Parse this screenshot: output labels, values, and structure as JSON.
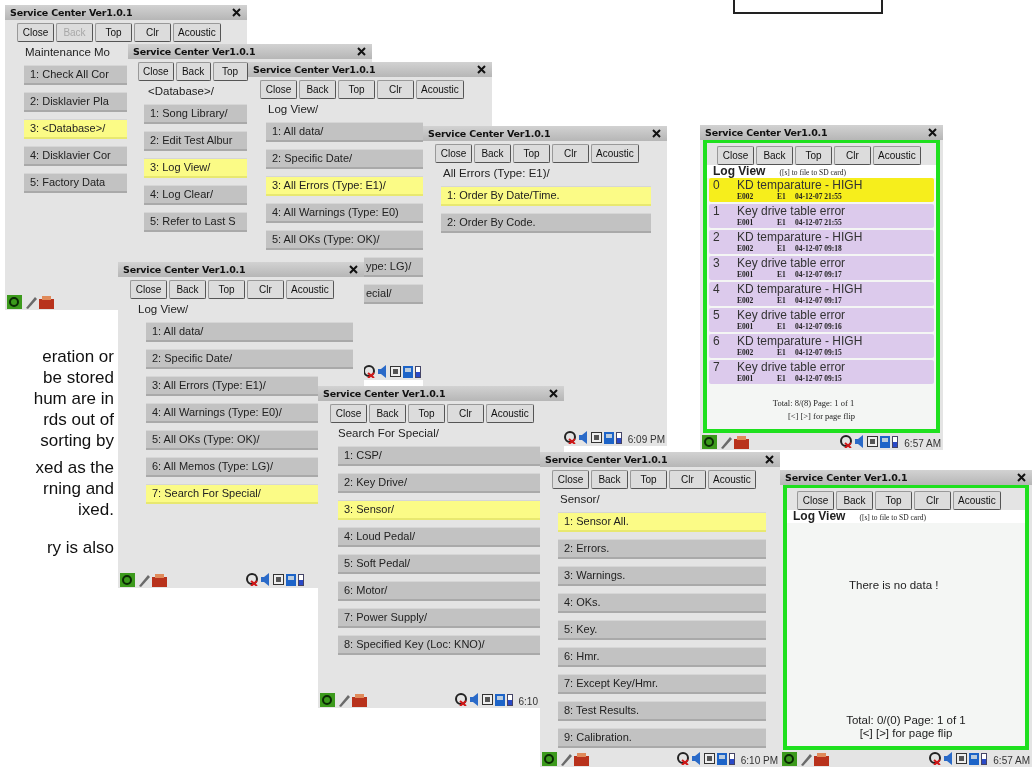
{
  "page_text": [
    [
      "eration or",
      "be stored",
      "hum are in",
      "rds out of",
      "sorting by"
    ],
    [
      "xed as the",
      "rning and",
      "ixed."
    ],
    [
      "ry is also"
    ]
  ],
  "windows": [
    {
      "kind": "menu",
      "title": "Service Center Ver1.0.1",
      "buttons": [
        {
          "label": "Close",
          "disabled": false
        },
        {
          "label": "Back",
          "disabled": true
        },
        {
          "label": "Top",
          "disabled": false
        },
        {
          "label": "Clr",
          "disabled": false
        },
        {
          "label": "Acoustic",
          "disabled": false
        }
      ],
      "heading": "Maintenance Mo",
      "items": [
        {
          "label": "1: Check All Cor",
          "selected": false
        },
        {
          "label": "2: Disklavier Pla",
          "selected": false
        },
        {
          "label": "3: <Database>/",
          "selected": true
        },
        {
          "label": "4: Disklavier Cor",
          "selected": false
        },
        {
          "label": "5: Factory Data",
          "selected": false
        }
      ],
      "taskbar": {
        "launcher_icons": true,
        "status_icons": false
      }
    },
    {
      "kind": "menu",
      "title": "Service Center Ver1.0.1",
      "buttons": [
        {
          "label": "Close",
          "disabled": false
        },
        {
          "label": "Back",
          "disabled": false
        },
        {
          "label": "Top",
          "disabled": false
        }
      ],
      "heading": "<Database>/",
      "items": [
        {
          "label": "1: Song Library/",
          "selected": false
        },
        {
          "label": "2: Edit Test Albur",
          "selected": false
        },
        {
          "label": "3: Log View/",
          "selected": true
        },
        {
          "label": "4: Log Clear/",
          "selected": false
        },
        {
          "label": "5: Refer to Last S",
          "selected": false
        }
      ]
    },
    {
      "kind": "menu",
      "title": "Service Center Ver1.0.1",
      "buttons": [
        {
          "label": "Close",
          "disabled": false
        },
        {
          "label": "Back",
          "disabled": false
        },
        {
          "label": "Top",
          "disabled": false
        },
        {
          "label": "Clr",
          "disabled": false
        },
        {
          "label": "Acoustic",
          "disabled": false
        }
      ],
      "heading": "Log View/",
      "items": [
        {
          "label": "1: All data/",
          "selected": false
        },
        {
          "label": "2: Specific Date/",
          "selected": false
        },
        {
          "label": "3: All Errors  (Type: E1)/",
          "selected": true
        },
        {
          "label": "4: All Warnings (Type: E0)",
          "selected": false
        },
        {
          "label": "5: All OKs (Type: OK)/",
          "selected": false
        },
        {
          "label": "ype: LG)/",
          "selected": false
        },
        {
          "label": "ecial/",
          "selected": false
        }
      ],
      "taskbar": {
        "launcher_icons": false,
        "status_icons": true
      }
    },
    {
      "kind": "menu",
      "title": "Service Center Ver1.0.1",
      "buttons": [
        {
          "label": "Close",
          "disabled": false
        },
        {
          "label": "Back",
          "disabled": false
        },
        {
          "label": "Top",
          "disabled": false
        },
        {
          "label": "Clr",
          "disabled": false
        },
        {
          "label": "Acoustic",
          "disabled": false
        }
      ],
      "heading": "All Errors  (Type: E1)/",
      "items": [
        {
          "label": "1: Order By Date/Time.",
          "selected": true
        },
        {
          "label": "2: Order By Code.",
          "selected": false
        }
      ],
      "taskbar": {
        "launcher_icons": false,
        "status_icons": true,
        "time": "6:09 PM"
      }
    },
    {
      "kind": "log",
      "title": "Service Center Ver1.0.1",
      "buttons": [
        {
          "label": "Close",
          "disabled": false
        },
        {
          "label": "Back",
          "disabled": false
        },
        {
          "label": "Top",
          "disabled": false
        },
        {
          "label": "Clr",
          "disabled": false
        },
        {
          "label": "Acoustic",
          "disabled": false
        }
      ],
      "heading": "Log View",
      "hint": "([s] to file to SD card)",
      "entries": [
        {
          "index": "0",
          "message": "KD temparature - HIGH",
          "code": "E002",
          "type": "E1",
          "time": "04-12-07 21:55",
          "selected": true
        },
        {
          "index": "1",
          "message": "Key drive table error",
          "code": "E001",
          "type": "E1",
          "time": "04-12-07 21:55",
          "selected": false
        },
        {
          "index": "2",
          "message": "KD temparature - HIGH",
          "code": "E002",
          "type": "E1",
          "time": "04-12-07 09:18",
          "selected": false
        },
        {
          "index": "3",
          "message": "Key drive table error",
          "code": "E001",
          "type": "E1",
          "time": "04-12-07 09:17",
          "selected": false
        },
        {
          "index": "4",
          "message": "KD temparature - HIGH",
          "code": "E002",
          "type": "E1",
          "time": "04-12-07 09:17",
          "selected": false
        },
        {
          "index": "5",
          "message": "Key drive table error",
          "code": "E001",
          "type": "E1",
          "time": "04-12-07 09:16",
          "selected": false
        },
        {
          "index": "6",
          "message": "KD temparature - HIGH",
          "code": "E002",
          "type": "E1",
          "time": "04-12-07 09:15",
          "selected": false
        },
        {
          "index": "7",
          "message": "Key drive table error",
          "code": "E001",
          "type": "E1",
          "time": "04-12-07 09:15",
          "selected": false
        }
      ],
      "total": "Total: 8/(8)  Page: 1 of 1",
      "flip_hint": "[<] [>] for page flip",
      "taskbar": {
        "launcher_icons": true,
        "status_icons": true,
        "time": "6:57 AM"
      }
    },
    {
      "kind": "menu",
      "title": "Service Center Ver1.0.1",
      "buttons": [
        {
          "label": "Close",
          "disabled": false
        },
        {
          "label": "Back",
          "disabled": false
        },
        {
          "label": "Top",
          "disabled": false
        },
        {
          "label": "Clr",
          "disabled": false
        },
        {
          "label": "Acoustic",
          "disabled": false
        }
      ],
      "heading": "Log View/",
      "items": [
        {
          "label": "1: All data/",
          "selected": false
        },
        {
          "label": "2: Specific Date/",
          "selected": false
        },
        {
          "label": "3: All Errors  (Type: E1)/",
          "selected": false
        },
        {
          "label": "4: All Warnings (Type: E0)/",
          "selected": false
        },
        {
          "label": "5: All OKs (Type: OK)/",
          "selected": false
        },
        {
          "label": "6: All Memos (Type: LG)/",
          "selected": false
        },
        {
          "label": "7: Search For Special/",
          "selected": true
        }
      ],
      "taskbar": {
        "launcher_icons": true,
        "status_icons": true
      }
    },
    {
      "kind": "menu",
      "title": "Service Center Ver1.0.1",
      "buttons": [
        {
          "label": "Close",
          "disabled": false
        },
        {
          "label": "Back",
          "disabled": false
        },
        {
          "label": "Top",
          "disabled": false
        },
        {
          "label": "Clr",
          "disabled": false
        },
        {
          "label": "Acoustic",
          "disabled": false
        }
      ],
      "heading": "Search For Special/",
      "items": [
        {
          "label": "1: CSP/",
          "selected": false
        },
        {
          "label": "2: Key Drive/",
          "selected": false
        },
        {
          "label": "3: Sensor/",
          "selected": true
        },
        {
          "label": "4: Loud Pedal/",
          "selected": false
        },
        {
          "label": "5: Soft Pedal/",
          "selected": false
        },
        {
          "label": "6: Motor/",
          "selected": false
        },
        {
          "label": "7: Power Supply/",
          "selected": false
        },
        {
          "label": "8: Specified Key (Loc: KNO)/",
          "selected": false
        }
      ],
      "taskbar": {
        "launcher_icons": true,
        "status_icons": true,
        "time": "6:10"
      }
    },
    {
      "kind": "menu",
      "title": "Service Center Ver1.0.1",
      "buttons": [
        {
          "label": "Close",
          "disabled": false
        },
        {
          "label": "Back",
          "disabled": false
        },
        {
          "label": "Top",
          "disabled": false
        },
        {
          "label": "Clr",
          "disabled": false
        },
        {
          "label": "Acoustic",
          "disabled": false
        }
      ],
      "heading": "Sensor/",
      "items": [
        {
          "label": "1: Sensor All.",
          "selected": true
        },
        {
          "label": "2: Errors.",
          "selected": false
        },
        {
          "label": "3: Warnings.",
          "selected": false
        },
        {
          "label": "4: OKs.",
          "selected": false
        },
        {
          "label": "5: Key.",
          "selected": false
        },
        {
          "label": "6: Hmr.",
          "selected": false
        },
        {
          "label": "7: Except Key/Hmr.",
          "selected": false
        },
        {
          "label": "8: Test Results.",
          "selected": false
        },
        {
          "label": "9: Calibration.",
          "selected": false
        }
      ],
      "taskbar": {
        "launcher_icons": true,
        "status_icons": true,
        "time": "6:10 PM"
      }
    },
    {
      "kind": "log",
      "title": "Service Center Ver1.0.1",
      "buttons": [
        {
          "label": "Close",
          "disabled": false
        },
        {
          "label": "Back",
          "disabled": false
        },
        {
          "label": "Top",
          "disabled": false
        },
        {
          "label": "Clr",
          "disabled": false
        },
        {
          "label": "Acoustic",
          "disabled": false
        }
      ],
      "heading": "Log View",
      "hint": "([s] to file to SD card)",
      "empty_message": "There is no data !",
      "total": "Total: 0/(0)  Page: 1 of 1",
      "flip_hint": "[<] [>] for page flip",
      "taskbar": {
        "launcher_icons": true,
        "status_icons": true,
        "time": "6:57 AM"
      }
    }
  ]
}
